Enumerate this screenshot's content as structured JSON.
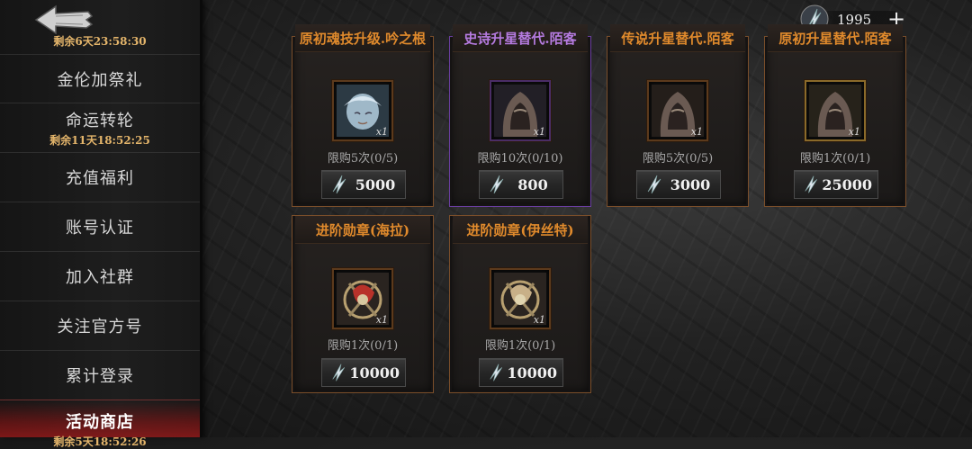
{
  "sidebar": {
    "back_timer": "剩余6天23:58:30",
    "items": [
      {
        "label": "金伦加祭礼",
        "timer": ""
      },
      {
        "label": "命运转轮",
        "timer": "剩余11天18:52:25"
      },
      {
        "label": "充值福利",
        "timer": ""
      },
      {
        "label": "账号认证",
        "timer": ""
      },
      {
        "label": "加入社群",
        "timer": ""
      },
      {
        "label": "关注官方号",
        "timer": ""
      },
      {
        "label": "累计登录",
        "timer": ""
      },
      {
        "label": "活动商店",
        "timer": "剩余5天18:52:26"
      }
    ]
  },
  "currency": {
    "amount": "1995",
    "plus": "+"
  },
  "shop": {
    "cards": [
      {
        "title": "原初魂技升级.吟之根",
        "limit": "限购5次(0/5)",
        "qty": "x1",
        "price": "5000"
      },
      {
        "title": "史诗升星替代.陌客",
        "limit": "限购10次(0/10)",
        "qty": "x1",
        "price": "800"
      },
      {
        "title": "传说升星替代.陌客",
        "limit": "限购5次(0/5)",
        "qty": "x1",
        "price": "3000"
      },
      {
        "title": "原初升星替代.陌客",
        "limit": "限购1次(0/1)",
        "qty": "x1",
        "price": "25000"
      },
      {
        "title": "进阶勋章(海拉)",
        "limit": "限购1次(0/1)",
        "qty": "x1",
        "price": "10000"
      },
      {
        "title": "进阶勋章(伊丝特)",
        "limit": "限购1次(0/1)",
        "qty": "x1",
        "price": "10000"
      }
    ]
  },
  "colors": {
    "accent_orange": "#e08a2c",
    "accent_purple": "#b57be0",
    "timer_gold": "#e4b56b",
    "active_red": "#aa1919"
  }
}
